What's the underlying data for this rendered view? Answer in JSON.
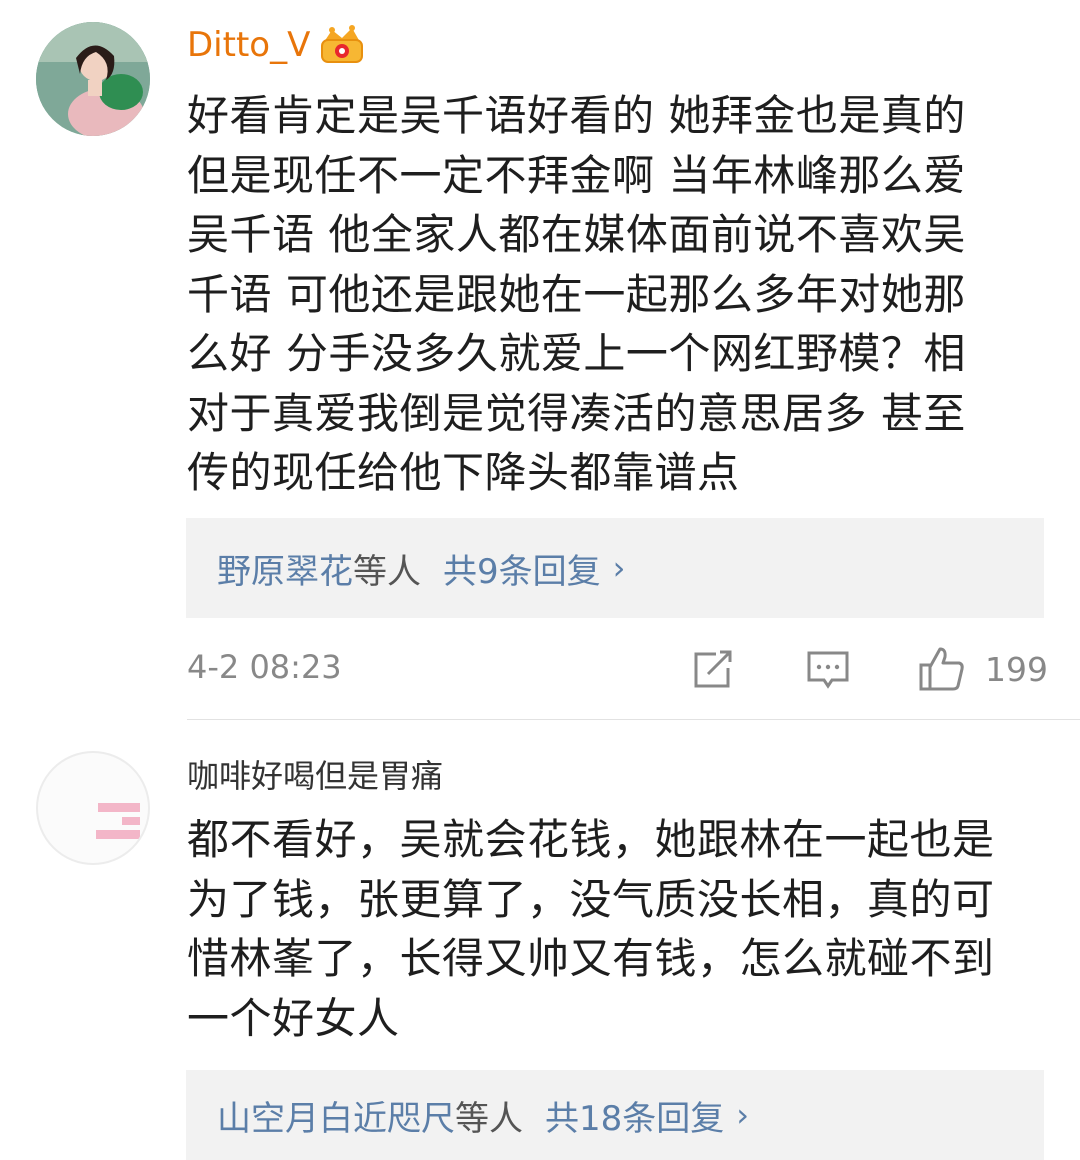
{
  "comments": [
    {
      "username": "Ditto_V",
      "badge_icon": "vip-crown-icon",
      "username_color": "#e8750a",
      "lines": [
        "好看肯定是吴千语好看的 她拜金也是真的",
        "但是现任不一定不拜金啊 当年林峰那么爱",
        "吴千语 他全家人都在媒体面前说不喜欢吴",
        "千语 可他还是跟她在一起那么多年对她那",
        "么好 分手没多久就爱上一个网红野模？相",
        "对于真爱我倒是觉得凑活的意思居多 甚至",
        "传的现任给他下降头都靠谱点"
      ],
      "reply": {
        "names": "野原翠花",
        "mid": "等人",
        "count": "共9条回复",
        "chevron": "›"
      },
      "timestamp": "4-2 08:23",
      "likes": "199"
    },
    {
      "username": "咖啡好喝但是胃痛",
      "lines": [
        "都不看好，吴就会花钱，她跟林在一起也是",
        "为了钱，张更算了，没气质没长相，真的可",
        "惜林峯了，长得又帅又有钱，怎么就碰不到",
        "一个好女人"
      ],
      "reply": {
        "names": "山空月白近咫尺",
        "mid": "等人",
        "count": "共18条回复",
        "chevron": "›"
      }
    }
  ],
  "colors": {
    "link": "#5b7ea8",
    "meta": "#888888",
    "reply_bg": "#f2f2f2"
  }
}
